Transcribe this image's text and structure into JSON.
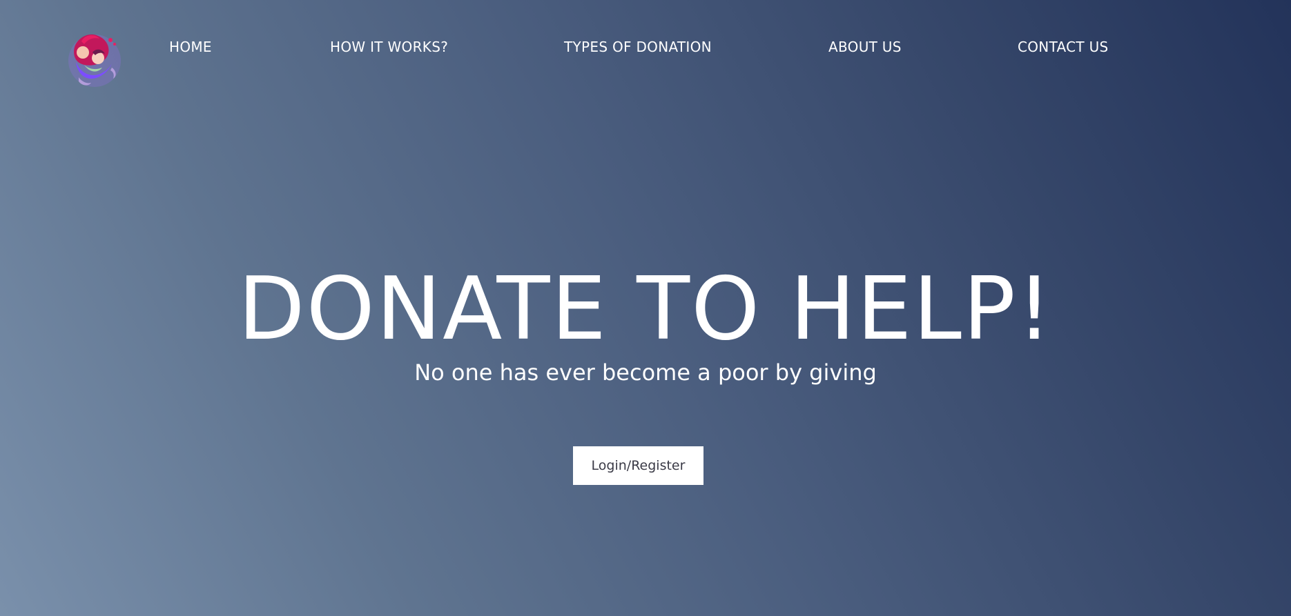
{
  "nav": {
    "items": [
      {
        "label": "HOME"
      },
      {
        "label": "HOW IT WORKS?"
      },
      {
        "label": "TYPES OF DONATION"
      },
      {
        "label": "ABOUT US"
      },
      {
        "label": "CONTACT US"
      }
    ]
  },
  "logo": {
    "icon": "mother-child-hug-icon"
  },
  "hero": {
    "title": "DONATE TO HELP!",
    "subtitle": "No one has ever become a poor by giving",
    "cta_label": "Login/Register"
  },
  "colors": {
    "gradient_start": "#7a90ab",
    "gradient_end": "#23335a",
    "text": "#ffffff",
    "button_bg": "#ffffff",
    "button_text": "#3a3a46"
  }
}
